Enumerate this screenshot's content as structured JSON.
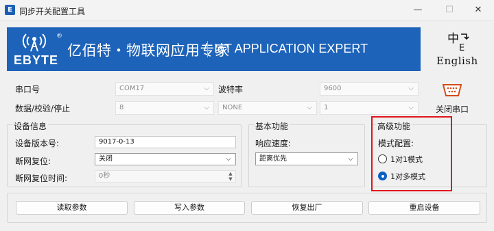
{
  "window": {
    "title": "同步开关配置工具",
    "app_icon_glyph": "E",
    "minimize_glyph": "—",
    "maximize_glyph": "☐",
    "close_glyph": "✕"
  },
  "banner": {
    "logo_text": "EBYTE",
    "logo_reg": "®",
    "cn_slogan": "亿佰特・物联网应用专家",
    "en_slogan": "IoT APPLICATION EXPERT",
    "bg_color": "#1d63b9"
  },
  "language": {
    "label": "English",
    "icon": "language-switch-icon"
  },
  "serial": {
    "port_label": "串口号",
    "port_value": "COM17",
    "baud_label": "波特率",
    "baud_value": "9600",
    "data_label": "数据/校验/停止",
    "data_bits": "8",
    "parity": "NONE",
    "stop_bits": "1",
    "close_port_label": "关闭串口",
    "port_icon": "serial-port-icon"
  },
  "device_info": {
    "title": "设备信息",
    "version_label": "设备版本号:",
    "version_value": "9017-0-13",
    "reset_label": "断网复位:",
    "reset_value": "关闭",
    "reset_time_label": "断网复位时间:",
    "reset_time_value": "0秒"
  },
  "basic": {
    "title": "基本功能",
    "speed_label": "响应速度:",
    "speed_value": "距离优先"
  },
  "advanced": {
    "title": "高级功能",
    "mode_label": "模式配置:",
    "options": [
      "1对1模式",
      "1对多模式"
    ],
    "selected_index": 1,
    "highlight_color": "#e0141b"
  },
  "actions": {
    "read": "读取参数",
    "write": "写入参数",
    "restore": "恢复出厂",
    "restart": "重启设备"
  }
}
